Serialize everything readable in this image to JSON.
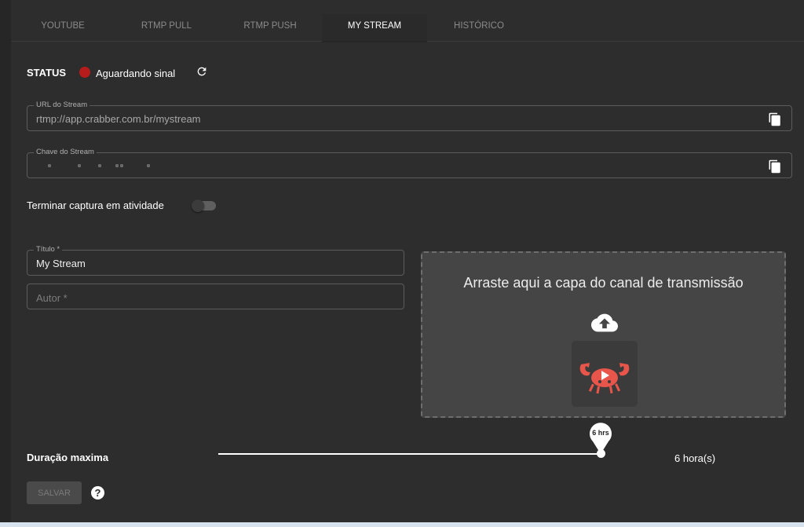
{
  "tabs": [
    {
      "label": "YOUTUBE",
      "active": false
    },
    {
      "label": "RTMP PULL",
      "active": false
    },
    {
      "label": "RTMP PUSH",
      "active": false
    },
    {
      "label": "MY STREAM",
      "active": true
    },
    {
      "label": "HISTÓRICO",
      "active": false
    }
  ],
  "status": {
    "label": "STATUS",
    "text": "Aguardando sinal",
    "indicator_color": "#b71c1c",
    "refresh_icon": "refresh-icon"
  },
  "stream_url": {
    "label": "URL do Stream",
    "value": "rtmp://app.crabber.com.br/mystream",
    "copy_icon": "copy-icon"
  },
  "stream_key": {
    "label": "Chave do Stream",
    "value_masked": true,
    "copy_icon": "copy-icon"
  },
  "toggle": {
    "label": "Terminar captura em atividade",
    "enabled": false
  },
  "title_field": {
    "label": "Título *",
    "value": "My Stream"
  },
  "author_field": {
    "placeholder": "Autor *"
  },
  "dropzone": {
    "text": "Arraste aqui a capa do canal de transmissão",
    "upload_icon": "cloud-upload-icon",
    "logo": "crab-logo",
    "logo_color": "#e8554a"
  },
  "duration": {
    "label": "Duração maxima",
    "tooltip": "6 hrs",
    "value_text": "6 hora(s)",
    "value": 6,
    "max": 6
  },
  "actions": {
    "save_label": "SALVAR",
    "help_label": "?"
  }
}
